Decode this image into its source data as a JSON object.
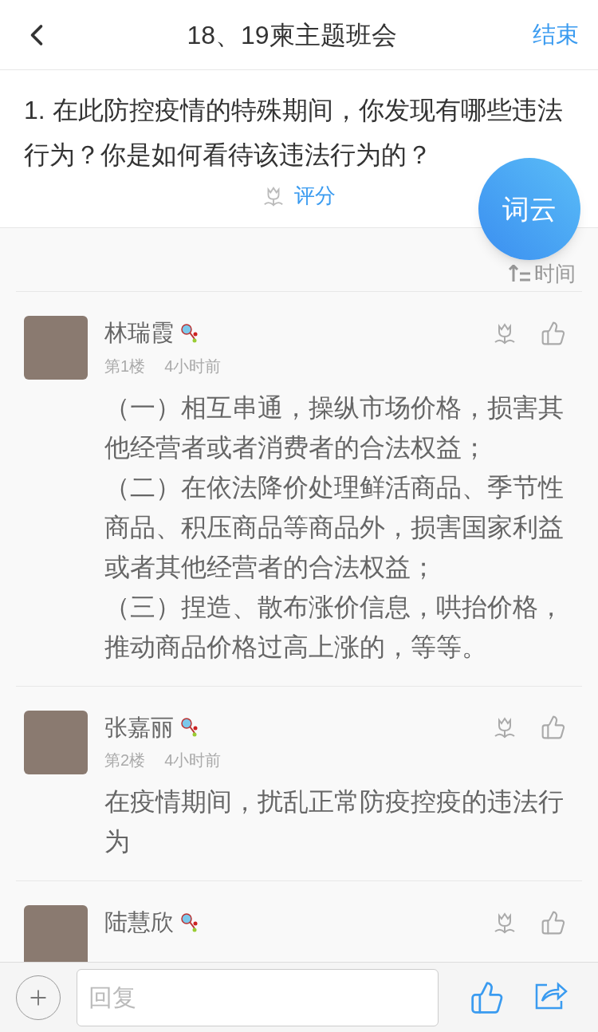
{
  "header": {
    "title": "18、19柬主题班会",
    "action": "结束"
  },
  "question": {
    "text": "1. 在此防控疫情的特殊期间，你发现有哪些违法行为？你是如何看待该违法行为的？",
    "rate_label": "评分"
  },
  "floating_button": "词云",
  "sort": {
    "label": "时间"
  },
  "comments": [
    {
      "name": "林瑞霞",
      "floor": "第1楼",
      "time": "4小时前",
      "paragraphs": [
        "（一）相互串通，操纵市场价格，损害其他经营者或者消费者的合法权益；",
        "（二）在依法降价处理鲜活商品、季节性商品、积压商品等商品外，损害国家利益或者其他经营者的合法权益；",
        "（三）捏造、散布涨价信息，哄抬价格，推动商品价格过高上涨的，等等。"
      ]
    },
    {
      "name": "张嘉丽",
      "floor": "第2楼",
      "time": "4小时前",
      "paragraphs": [
        "在疫情期间，扰乱正常防疫控疫的违法行为"
      ]
    },
    {
      "name": "陆慧欣"
    }
  ],
  "reply": {
    "placeholder": "回复"
  }
}
